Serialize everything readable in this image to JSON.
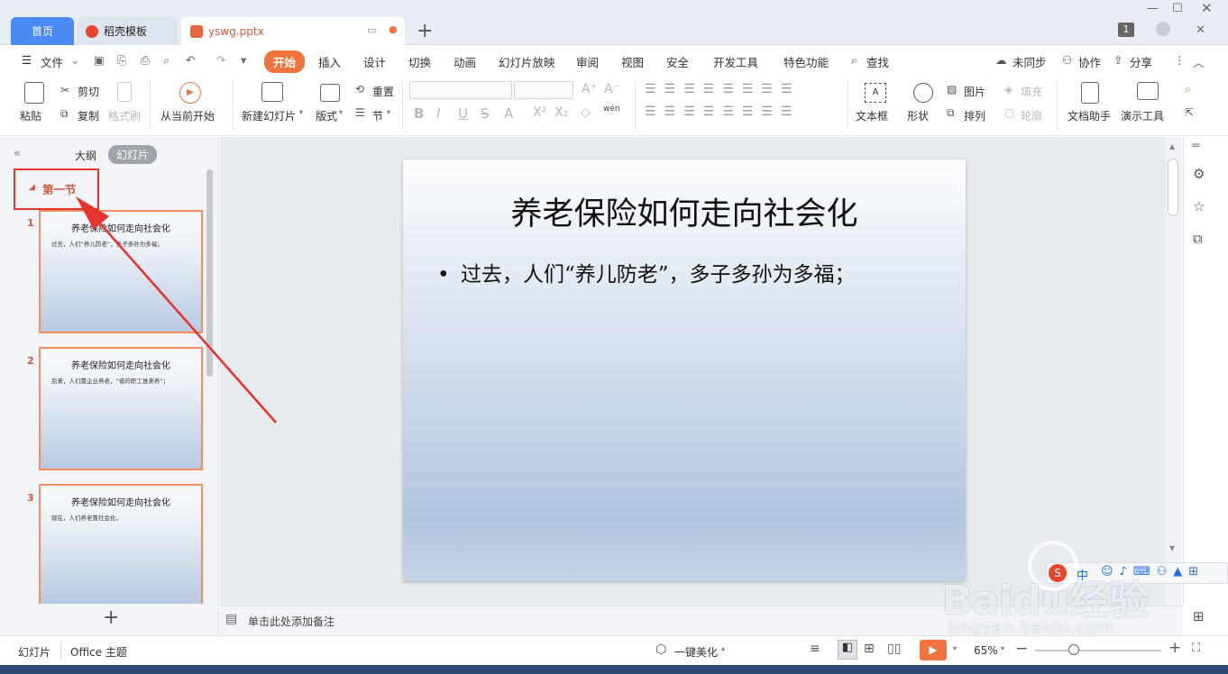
{
  "tabs": {
    "home": "首页",
    "template": "稻壳模板",
    "document": "yswg.pptx",
    "window_badge": "1"
  },
  "menu": {
    "file": "文件",
    "items": [
      "开始",
      "插入",
      "设计",
      "切换",
      "动画",
      "幻灯片放映",
      "审阅",
      "视图",
      "安全",
      "开发工具",
      "特色功能"
    ],
    "search": "查找",
    "sync": "未同步",
    "collab": "协作",
    "share": "分享"
  },
  "ribbon": {
    "paste": "粘贴",
    "cut": "剪切",
    "copy": "复制",
    "format_painter": "格式刷",
    "play_from_current": "从当前开始",
    "new_slide": "新建幻灯片",
    "layout": "版式",
    "reset": "重置",
    "section": "节",
    "textbox": "文本框",
    "shape": "形状",
    "picture": "图片",
    "arrange": "排列",
    "fill": "填充",
    "outline": "轮廓",
    "doc_helper": "文档助手",
    "presentation_tool": "演示工具",
    "pinyin": "wén"
  },
  "left_panel": {
    "outline_tab": "大纲",
    "slides_tab": "幻灯片",
    "section_label": "第一节",
    "slides": [
      {
        "num": "1",
        "title": "养老保险如何走向社会化",
        "bullet": "过去，人们“养儿防老”，多子多孙为多福；"
      },
      {
        "num": "2",
        "title": "养老保险如何走向社会化",
        "bullet": "后来，人们靠企业养老，“借的职工谁来养”；"
      },
      {
        "num": "3",
        "title": "养老保险如何走向社会化",
        "bullet": "现在，人们养老靠社会化。"
      }
    ]
  },
  "slide": {
    "title": "养老保险如何走向社会化",
    "bullet": "过去，人们“养儿防老”，多子多孙为多福；"
  },
  "notes_placeholder": "单击此处添加备注",
  "status": {
    "slides": "幻灯片",
    "theme": "Office 主题",
    "beautify": "一键美化",
    "zoom": "65%"
  },
  "watermark": {
    "brand": "Baidu经验",
    "url": "jingyan.baidu.com"
  },
  "ime": {
    "lang": "中"
  },
  "colors": {
    "accent": "#f0733e",
    "tab_active": "#4a8af4",
    "annotation": "#e8332d"
  }
}
